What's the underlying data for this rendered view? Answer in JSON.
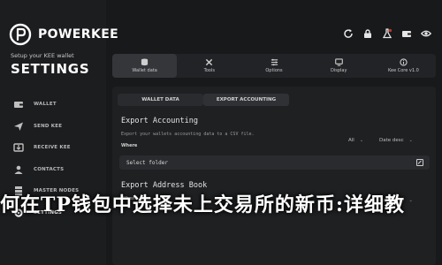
{
  "brand": {
    "name": "POWERKEE"
  },
  "sidebar": {
    "subtitle": "Setup your KEE wallet",
    "title": "SETTINGS",
    "items": [
      {
        "label": "WALLET",
        "icon": "wallet-icon",
        "active": false
      },
      {
        "label": "SEND KEE",
        "icon": "send-icon",
        "active": false
      },
      {
        "label": "RECEIVE KEE",
        "icon": "receive-icon",
        "active": false
      },
      {
        "label": "CONTACTS",
        "icon": "contacts-icon",
        "active": false
      },
      {
        "label": "MASTER NODES",
        "icon": "masternodes-icon",
        "active": false
      },
      {
        "label": "SETTINGS",
        "icon": "settings-icon",
        "active": true
      }
    ]
  },
  "top_icons": [
    "refresh-icon",
    "lock-icon",
    "flask-icon",
    "wallet-icon",
    "eye-icon"
  ],
  "top_tabs": [
    {
      "label": "Wallet data",
      "icon": "database-icon",
      "active": true
    },
    {
      "label": "Tools",
      "icon": "tools-icon",
      "active": false
    },
    {
      "label": "Options",
      "icon": "options-icon",
      "active": false
    },
    {
      "label": "Display",
      "icon": "display-icon",
      "active": false
    },
    {
      "label": "Kee Core v1.0",
      "icon": "info-icon",
      "active": false
    }
  ],
  "inner_tabs": [
    {
      "label": "WALLET DATA",
      "active": false
    },
    {
      "label": "EXPORT ACCOUNTING",
      "active": true
    }
  ],
  "export_accounting": {
    "title": "Export Accounting",
    "description": "Export your wallets accounting data to a CSV file.",
    "where_label": "Where",
    "filter_all": "All",
    "sort": "Date desc",
    "folder_label": "Select folder"
  },
  "export_address_book": {
    "title": "Export Address Book",
    "where_label": "Where",
    "filter_all": "All",
    "sort": "Date desc"
  },
  "caption": "何在TP钱包中选择未上交易所的新币:详细教",
  "colors": {
    "background": "#18191b",
    "panel": "#1f2022",
    "accent_red": "#c0392b",
    "text": "#ffffff"
  }
}
